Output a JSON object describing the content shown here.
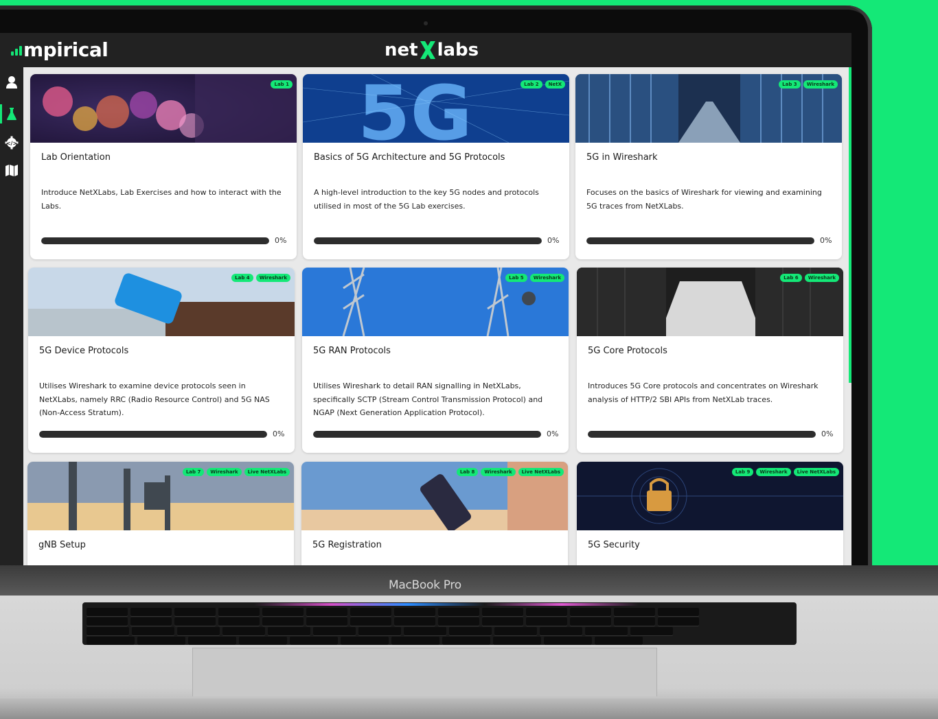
{
  "header": {
    "logo_left": "mpirical",
    "logo_center_prefix": "net",
    "logo_center_suffix": "labs"
  },
  "sidebar": {
    "items": [
      {
        "icon": "user-icon"
      },
      {
        "icon": "flask-icon"
      },
      {
        "icon": "code-gear-icon"
      },
      {
        "icon": "map-icon"
      }
    ]
  },
  "cards": [
    {
      "title": "Lab Orientation",
      "description": "Introduce NetXLabs, Lab Exercises and how to interact with the Labs.",
      "tags": [
        "Lab 1"
      ],
      "progress": 0,
      "progress_label": "0%"
    },
    {
      "title": "Basics of 5G Architecture and 5G Protocols",
      "description": "A high-level introduction to the key 5G nodes and protocols utilised in most of the 5G Lab exercises.",
      "tags": [
        "Lab 2",
        "NetX"
      ],
      "progress": 0,
      "progress_label": "0%"
    },
    {
      "title": "5G in Wireshark",
      "description": "Focuses on the basics of Wireshark for viewing and examining 5G traces from NetXLabs.",
      "tags": [
        "Lab 3",
        "Wireshark"
      ],
      "progress": 0,
      "progress_label": "0%"
    },
    {
      "title": "5G Device Protocols",
      "description": "Utilises Wireshark to examine device protocols seen in NetXLabs, namely RRC (Radio Resource Control) and 5G NAS (Non-Access Stratum).",
      "tags": [
        "Lab 4",
        "Wireshark"
      ],
      "progress": 0,
      "progress_label": "0%"
    },
    {
      "title": "5G RAN Protocols",
      "description": "Utilises Wireshark to detail RAN signalling in NetXLabs, specifically SCTP (Stream Control Transmission Protocol) and NGAP (Next Generation Application Protocol).",
      "tags": [
        "Lab 5",
        "Wireshark"
      ],
      "progress": 0,
      "progress_label": "0%"
    },
    {
      "title": "5G Core Protocols",
      "description": "Introduces 5G Core protocols and concentrates on Wireshark analysis of HTTP/2 SBI APIs from NetXLab traces.",
      "tags": [
        "Lab 6",
        "Wireshark"
      ],
      "progress": 0,
      "progress_label": "0%"
    },
    {
      "title": "gNB Setup",
      "description": "",
      "tags": [
        "Lab 7",
        "Wireshark",
        "Live NetXLabs"
      ],
      "progress": null,
      "progress_label": ""
    },
    {
      "title": "5G Registration",
      "description": "",
      "tags": [
        "Lab 8",
        "Wireshark",
        "Live NetXLabs"
      ],
      "progress": null,
      "progress_label": ""
    },
    {
      "title": "5G Security",
      "description": "",
      "tags": [
        "Lab 9",
        "Wireshark",
        "Live NetXLabs"
      ],
      "progress": null,
      "progress_label": ""
    }
  ],
  "device_label": "MacBook Pro",
  "colors": {
    "accent": "#14e877",
    "topbar": "#222222",
    "progress_fill": "#2d2d2d"
  }
}
